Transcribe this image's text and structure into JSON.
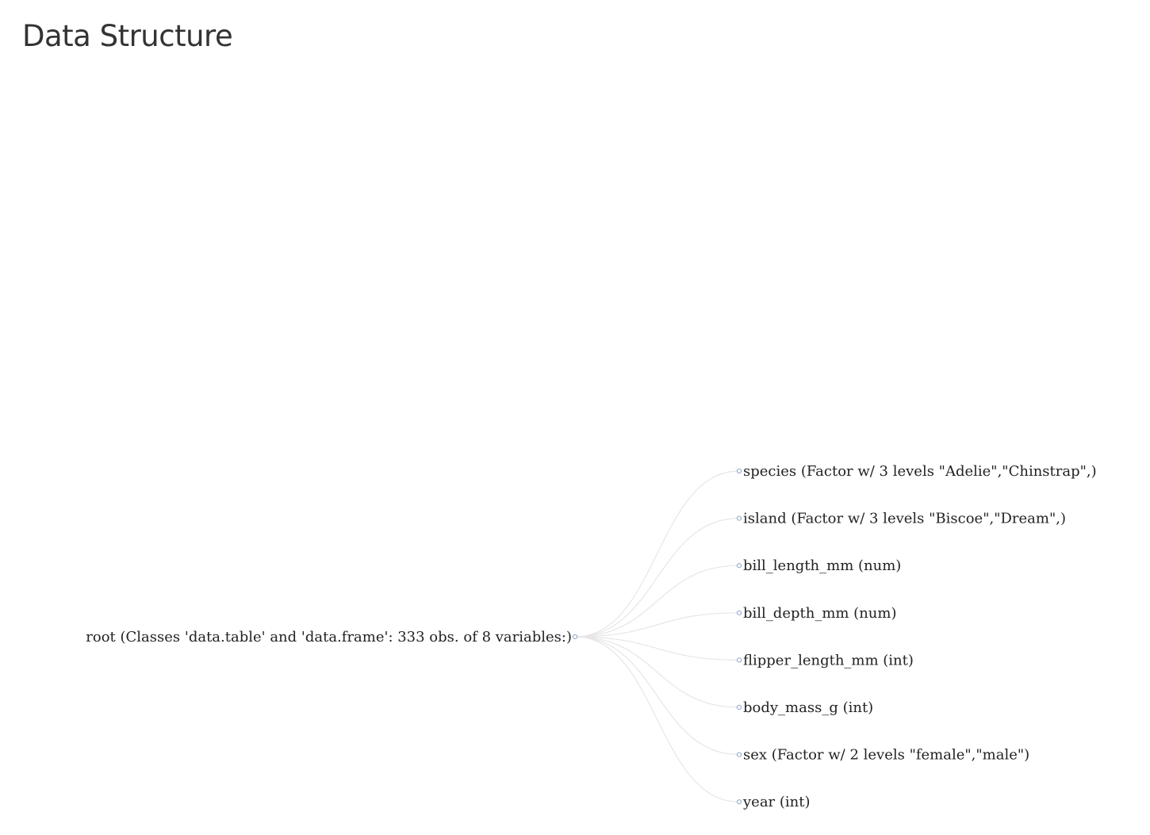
{
  "page": {
    "title": "Data Structure"
  },
  "tree": {
    "root": {
      "label": "root (Classes 'data.table' and 'data.frame': 333 obs. of 8 variables:)"
    },
    "children": [
      {
        "label": "species (Factor w/ 3 levels \"Adelie\",\"Chinstrap\",)"
      },
      {
        "label": "island (Factor w/ 3 levels \"Biscoe\",\"Dream\",)"
      },
      {
        "label": "bill_length_mm (num)"
      },
      {
        "label": "bill_depth_mm (num)"
      },
      {
        "label": "flipper_length_mm (int)"
      },
      {
        "label": "body_mass_g (int)"
      },
      {
        "label": "sex (Factor w/ 2 levels \"female\",\"male\")"
      },
      {
        "label": "year (int)"
      }
    ]
  },
  "colors": {
    "link": "#e6e6e6",
    "node_stroke": "#8fa6c8",
    "text": "#222222",
    "title": "#333333"
  }
}
